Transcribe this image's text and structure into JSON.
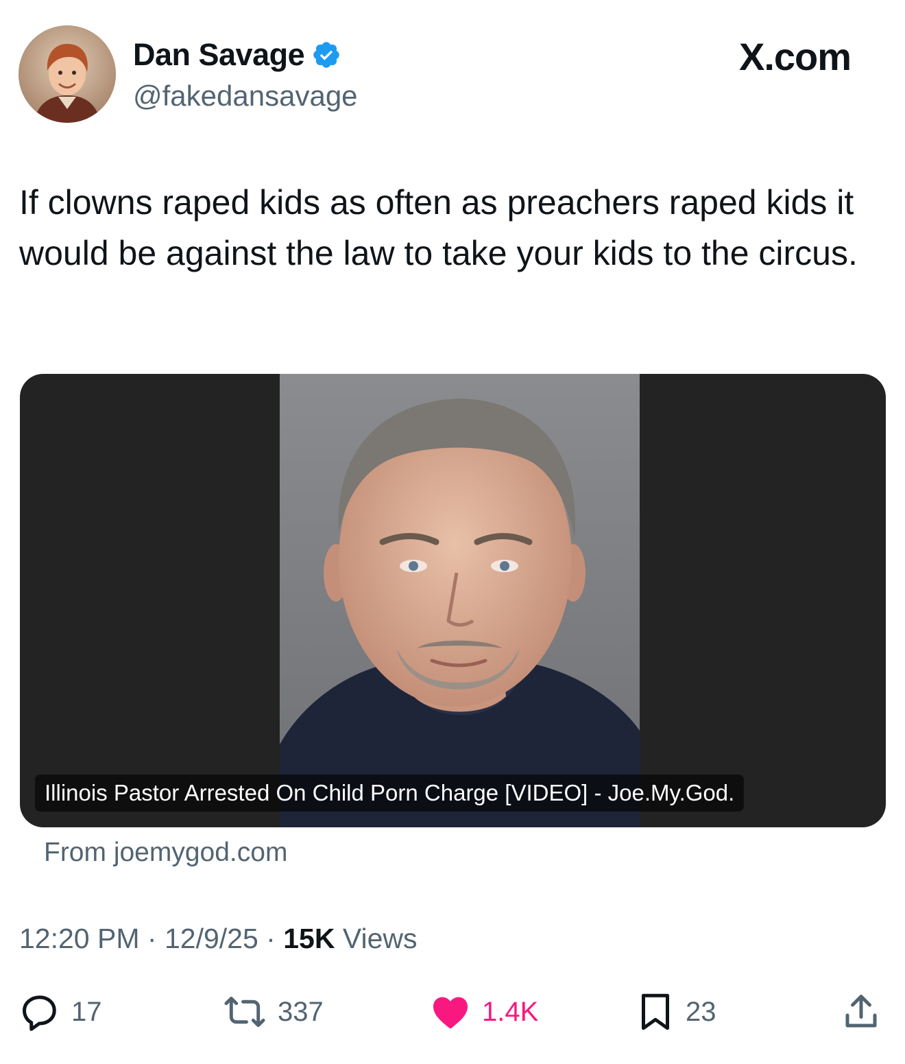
{
  "author": {
    "display_name": "Dan Savage",
    "handle": "@fakedansavage",
    "verified": true,
    "avatar_icon": "child-portrait-avatar"
  },
  "site_label": "X.com",
  "tweet": {
    "text": "If clowns raped kids as often as preachers raped kids it would be against the law to take your kids to the circus."
  },
  "card": {
    "caption": "Illinois Pastor Arrested On Child Porn Charge [VIDEO] - Joe.My.God.",
    "image_icon": "mugshot-photo",
    "source": "From joemygod.com"
  },
  "meta": {
    "time": "12:20 PM",
    "separator": "·",
    "date": "12/9/25",
    "views_count": "15K",
    "views_label": "Views"
  },
  "actions": {
    "replies": "17",
    "reposts": "337",
    "likes": "1.4K",
    "bookmarks": "23"
  },
  "colors": {
    "text_primary": "#0f1419",
    "text_secondary": "#536471",
    "verified_blue": "#1d9bf0",
    "like_pink": "#f91880",
    "card_background": "#232323"
  }
}
